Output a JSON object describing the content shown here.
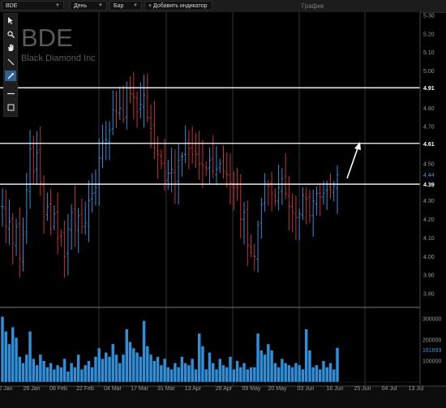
{
  "topbar": {
    "symbol": "BDE",
    "interval": "День",
    "chart_style": "Бар",
    "add_indicator": "+ Добавить индикатор",
    "window_title": "График"
  },
  "watermark": {
    "symbol": "BDE",
    "company": "Black Diamond Inc"
  },
  "tools": [
    "cursor-icon",
    "zoom-icon",
    "hand-icon",
    "line-icon",
    "arrow-tool-icon",
    "horizontal-line-icon",
    "rectangle-icon"
  ],
  "colors": {
    "up": "#2f8fd8",
    "down": "#c8323a",
    "volume": "#2f8fd8",
    "level": "#ffffff",
    "last_price": "#3b9be0",
    "grid": "#555555",
    "axis_text": "#9a9a9a"
  },
  "price_axis": {
    "ticks": [
      "5.30",
      "5.20",
      "5.10",
      "5.00",
      "4.90",
      "4.80",
      "4.70",
      "4.60",
      "4.50",
      "4.40",
      "4.30",
      "4.20",
      "4.10",
      "4.00",
      "3.90",
      "3.80"
    ],
    "last_price": "4.44"
  },
  "levels": [
    {
      "label": "4.91",
      "value": 4.91
    },
    {
      "label": "4.61",
      "value": 4.61
    },
    {
      "label": "4.39",
      "value": 4.39
    }
  ],
  "volume_axis": {
    "ticks": [
      "300000",
      "200000",
      "100000"
    ],
    "last_volume": "161893"
  },
  "date_axis": [
    "2 Jan",
    "26 Jan",
    "08 Feb",
    "22 Feb",
    "04 Mar",
    "17 Mar",
    "31 Mar",
    "13 Apr",
    "26 Apr",
    "09 May",
    "20 May",
    "03 Jun",
    "16 Jun",
    "25 Jun",
    "04 Jul",
    "13 Jul"
  ],
  "chart_data": {
    "type": "bar",
    "ylim": [
      3.75,
      5.32
    ],
    "series": [
      {
        "values": [
          4.27,
          4.16,
          4.19,
          4.07,
          4.16,
          3.99,
          4.12,
          4.36,
          4.58,
          4.46,
          4.56,
          4.4,
          4.24,
          4.27,
          4.15,
          4.23,
          4.1,
          4.11,
          4.0,
          4.15,
          4.24,
          4.16,
          4.22,
          4.16,
          4.18,
          4.3,
          4.34,
          4.37,
          4.53,
          4.62,
          4.63,
          4.68,
          4.79,
          4.78,
          4.8,
          4.74,
          4.91,
          4.88,
          4.86,
          4.78,
          4.82,
          4.87,
          4.75,
          4.69,
          4.59,
          4.55,
          4.5,
          4.4,
          4.45,
          4.47,
          4.4,
          4.52,
          4.54,
          4.61,
          4.58,
          4.55,
          4.55,
          4.5,
          4.49,
          4.47,
          4.52,
          4.46,
          4.47,
          4.5,
          4.46,
          4.44,
          4.4,
          4.37,
          4.37,
          4.2,
          4.24,
          4.06,
          4.02,
          4.0,
          4.17,
          4.28,
          4.4,
          4.38,
          4.34,
          4.3,
          4.37,
          4.42,
          4.34,
          4.27,
          4.24,
          4.21,
          4.23,
          4.33,
          4.31,
          4.22,
          4.3,
          4.34,
          4.32,
          4.34,
          4.36,
          4.36,
          4.38,
          4.44
        ]
      },
      {
        "values": [
          310000,
          240000,
          180000,
          260000,
          210000,
          120000,
          90000,
          130000,
          240000,
          110000,
          80000,
          130000,
          100000,
          70000,
          90000,
          60000,
          80000,
          70000,
          110000,
          50000,
          90000,
          70000,
          130000,
          60000,
          80000,
          100000,
          70000,
          120000,
          160000,
          110000,
          140000,
          120000,
          180000,
          130000,
          90000,
          130000,
          250000,
          190000,
          160000,
          140000,
          120000,
          290000,
          170000,
          130000,
          100000,
          120000,
          80000,
          110000,
          70000,
          60000,
          90000,
          70000,
          120000,
          90000,
          80000,
          110000,
          60000,
          230000,
          170000,
          60000,
          140000,
          90000,
          60000,
          110000,
          80000,
          70000,
          120000,
          60000,
          100000,
          70000,
          90000,
          60000,
          70000,
          70000,
          230000,
          150000,
          130000,
          180000,
          150000,
          90000,
          70000,
          110000,
          90000,
          80000,
          70000,
          90000,
          80000,
          60000,
          250000,
          150000,
          70000,
          80000,
          60000,
          100000,
          70000,
          90000,
          60000,
          161893
        ]
      }
    ]
  }
}
